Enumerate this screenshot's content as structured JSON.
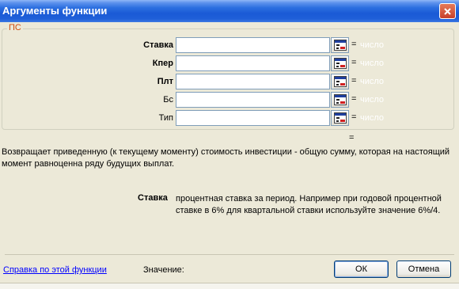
{
  "window": {
    "title": "Аргументы функции"
  },
  "group": {
    "legend": "ПС",
    "fields": [
      {
        "label": "Ставка",
        "bold": true,
        "value": "",
        "equals": "=",
        "result": "число"
      },
      {
        "label": "Кпер",
        "bold": true,
        "value": "",
        "equals": "=",
        "result": "число"
      },
      {
        "label": "Плт",
        "bold": true,
        "value": "",
        "equals": "=",
        "result": "число"
      },
      {
        "label": "Бс",
        "bold": false,
        "value": "",
        "equals": "=",
        "result": "число"
      },
      {
        "label": "Тип",
        "bold": false,
        "value": "",
        "equals": "=",
        "result": "число"
      }
    ]
  },
  "total_equals": "=",
  "description": "Возвращает приведенную (к текущему моменту) стоимость инвестиции - общую сумму, которая на настоящий момент равноценна ряду будущих выплат.",
  "argument_help": {
    "name": "Ставка",
    "text": "процентная ставка за период. Например при годовой процентной ставке в 6% для квартальной ставки используйте значение 6%/4."
  },
  "footer": {
    "help_link": "Справка по этой функции",
    "value_label": "Значение:",
    "ok_label": "ОК",
    "cancel_label": "Отмена"
  },
  "colors": {
    "legend": "#d04c0d",
    "link": "#0000ff",
    "titlebar": "#1a5ad6"
  },
  "icons": {
    "close": "close-icon",
    "collapse": "collapse-dialog-icon"
  }
}
